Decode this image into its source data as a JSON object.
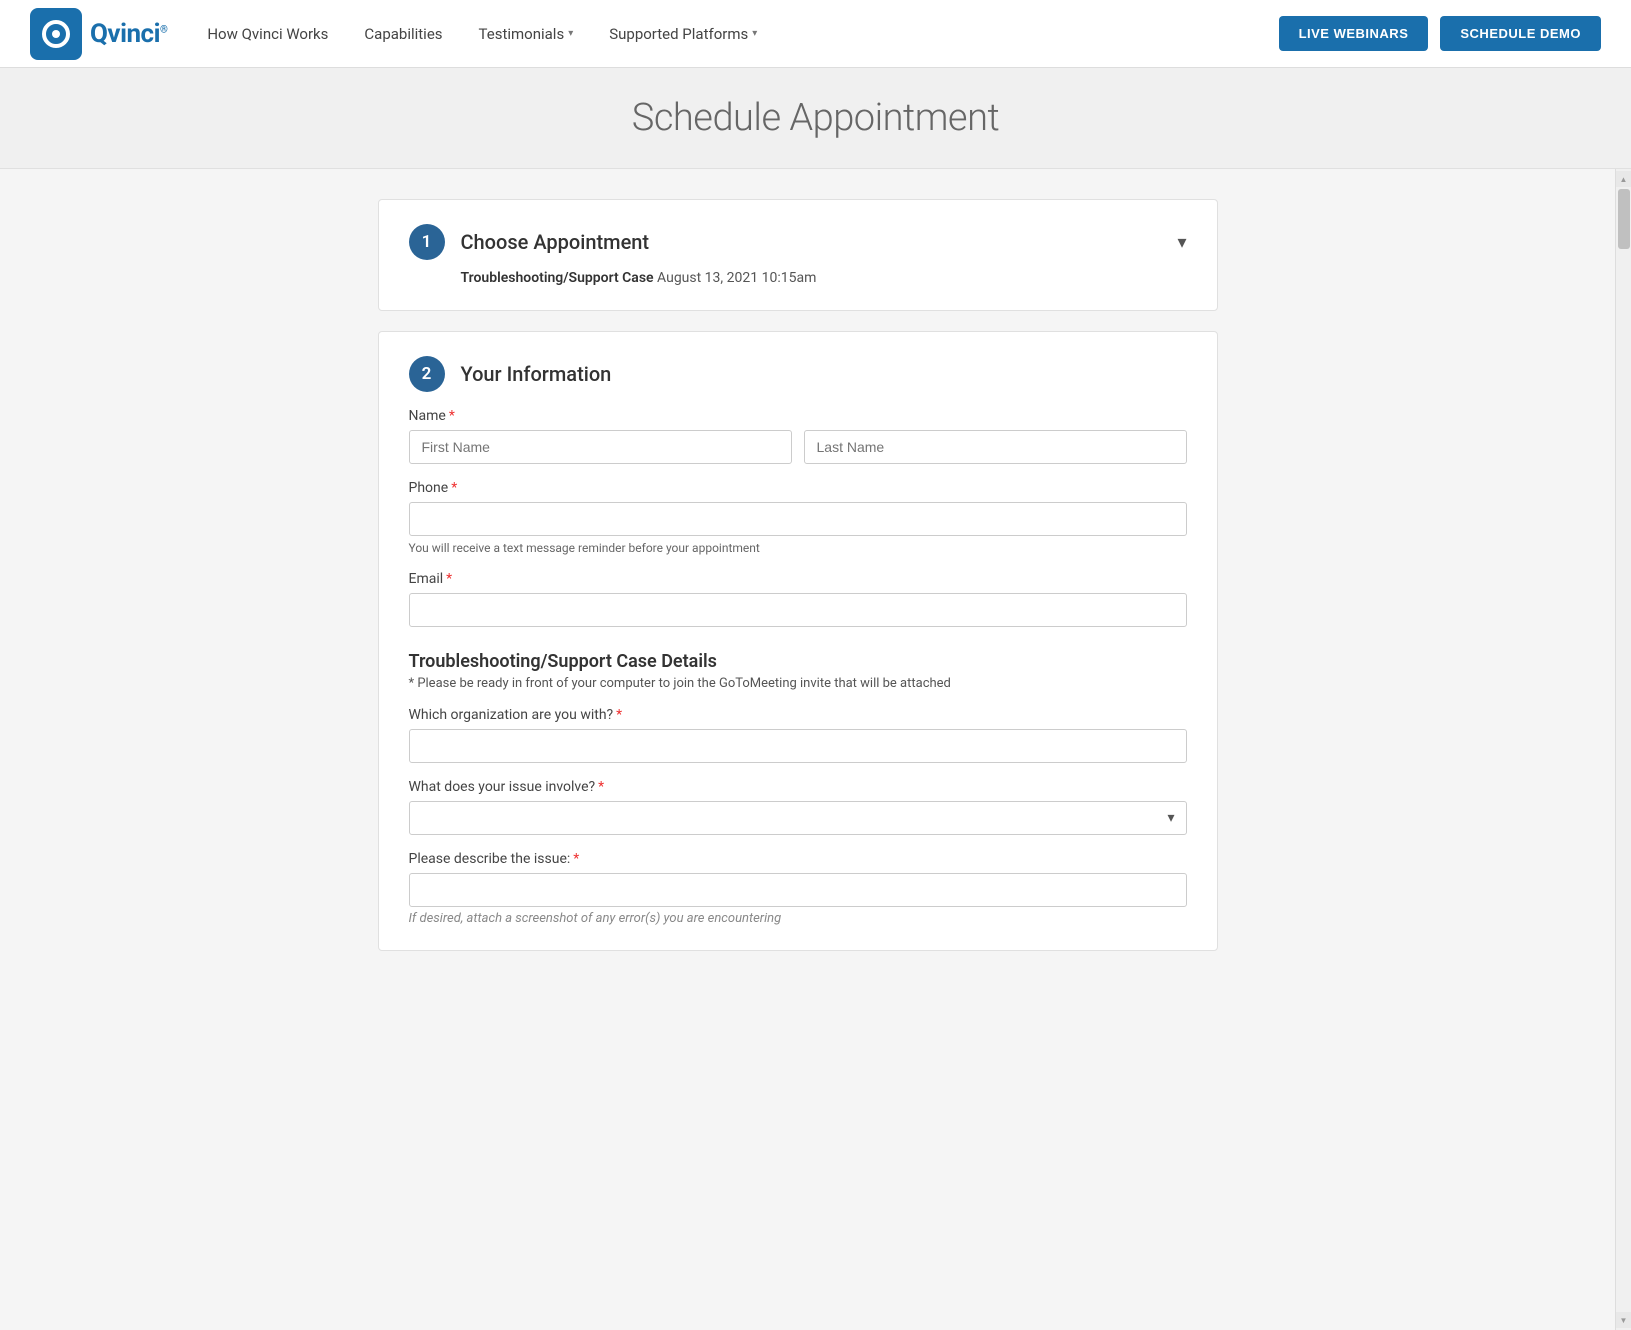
{
  "navbar": {
    "logo_text": "Qvinci",
    "logo_registered": "®",
    "nav_items": [
      {
        "label": "How Qvinci Works",
        "has_dropdown": false
      },
      {
        "label": "Capabilities",
        "has_dropdown": false
      },
      {
        "label": "Testimonials",
        "has_dropdown": true
      },
      {
        "label": "Supported Platforms",
        "has_dropdown": true
      }
    ],
    "btn_live": "LIVE WEBINARS",
    "btn_demo": "SCHEDULE DEMO"
  },
  "page": {
    "title": "Schedule Appointment"
  },
  "step1": {
    "badge": "1",
    "title": "Choose Appointment",
    "appointment_type": "Troubleshooting/Support Case",
    "appointment_datetime": "August 13, 2021 10:15am"
  },
  "step2": {
    "badge": "2",
    "title": "Your Information",
    "name_label": "Name",
    "first_name_placeholder": "First Name",
    "last_name_placeholder": "Last Name",
    "phone_label": "Phone",
    "phone_hint": "You will receive a text message reminder before your appointment",
    "email_label": "Email",
    "support_section_title": "Troubleshooting/Support Case Details",
    "support_section_note": "* Please be ready in front of your computer to join the GoToMeeting invite that will be attached",
    "org_label": "Which organization are you with?",
    "issue_label": "What does your issue involve?",
    "describe_label": "Please describe the issue:",
    "partial_text": "If desired, attach a screenshot of any error(s) you are encountering"
  },
  "scrollbar": {
    "up_arrow": "▲",
    "down_arrow": "▼"
  }
}
